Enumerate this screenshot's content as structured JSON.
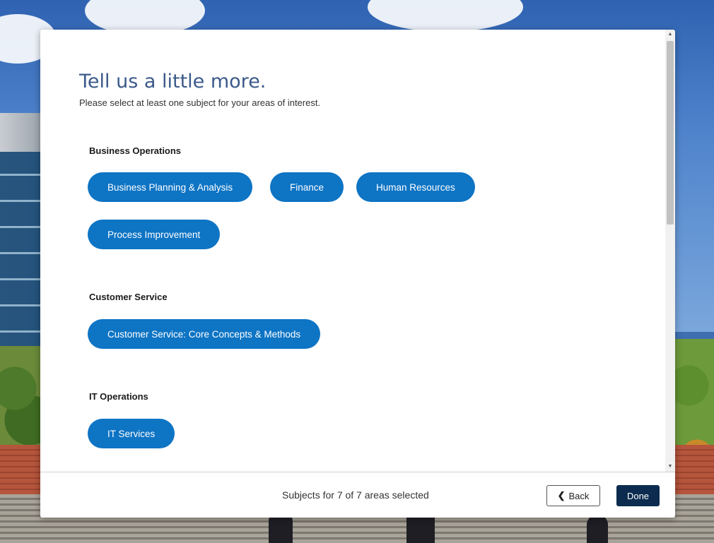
{
  "header": {
    "title": "Tell us a little more.",
    "subtitle": "Please select at least one subject for your areas of interest."
  },
  "sections": [
    {
      "title": "Business Operations",
      "subjects": [
        "Business Planning & Analysis",
        "Finance",
        "Human Resources",
        "Process Improvement"
      ]
    },
    {
      "title": "Customer Service",
      "subjects": [
        "Customer Service: Core Concepts & Methods"
      ]
    },
    {
      "title": "IT Operations",
      "subjects": [
        "IT Services"
      ]
    }
  ],
  "footer": {
    "status": "Subjects for 7 of 7 areas selected",
    "back_label": "Back",
    "done_label": "Done"
  },
  "colors": {
    "chip": "#0e74c4",
    "done_button": "#0c2b4f",
    "title": "#3b5a8a"
  },
  "icons": {
    "back": "chevron-left-icon",
    "scroll_up": "scroll-up-arrow-icon",
    "scroll_down": "scroll-down-arrow-icon"
  }
}
